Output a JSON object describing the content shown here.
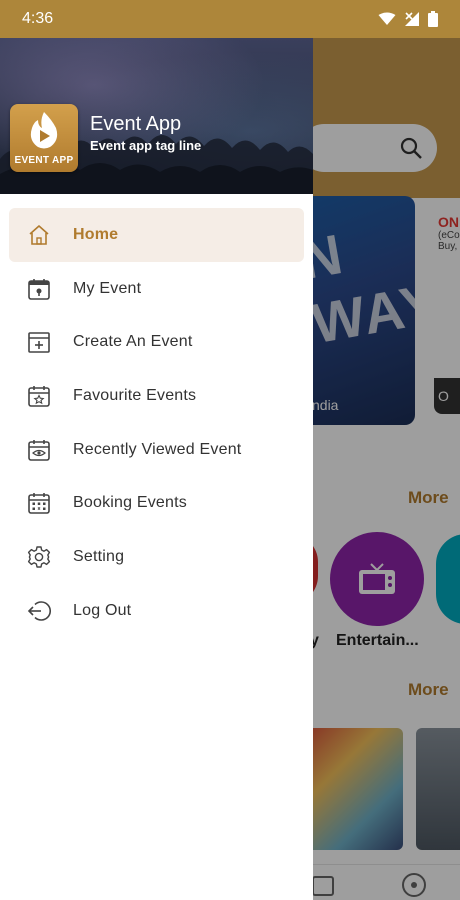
{
  "status_bar": {
    "time": "4:36"
  },
  "drawer": {
    "app_name": "Event App",
    "tagline": "Event app tag line",
    "logo_text": "EVENT APP",
    "menu": [
      {
        "label": "Home",
        "icon": "home-icon",
        "active": true
      },
      {
        "label": "My Event",
        "icon": "calendar-pin-icon",
        "active": false
      },
      {
        "label": "Create An Event",
        "icon": "add-event-icon",
        "active": false
      },
      {
        "label": "Favourite Events",
        "icon": "star-calendar-icon",
        "active": false
      },
      {
        "label": "Recently Viewed Event",
        "icon": "eye-calendar-icon",
        "active": false
      },
      {
        "label": "Booking Events",
        "icon": "booking-calendar-icon",
        "active": false
      },
      {
        "label": "Setting",
        "icon": "gear-icon",
        "active": false
      },
      {
        "label": "Log Out",
        "icon": "logout-icon",
        "active": false
      }
    ]
  },
  "background": {
    "card1_caption": "ndia",
    "card1_art_text": "N WAY",
    "card2_title": "ON",
    "card2_line1": "(eCo",
    "card2_line2": "Buy,",
    "card2_footer": "O",
    "more_1": "More",
    "more_2": "More",
    "category_caption": "Entertain...",
    "category_caption_left": "y"
  },
  "colors": {
    "accent": "#b07b2e",
    "status_bar": "#ad863a",
    "active_item_bg": "#f5ede6"
  }
}
